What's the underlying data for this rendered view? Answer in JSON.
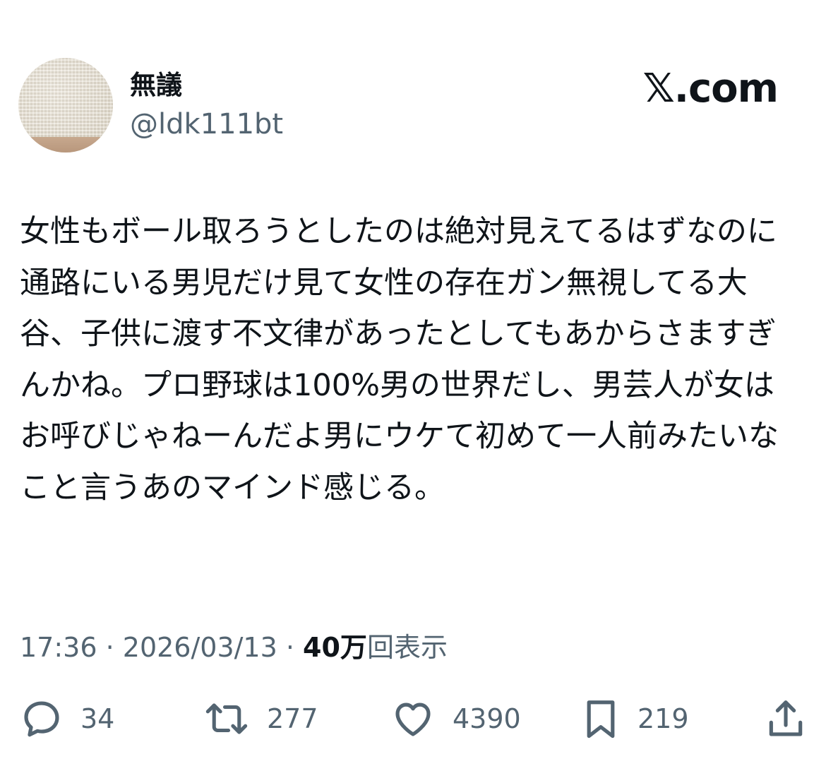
{
  "header": {
    "display_name": "無議",
    "handle": "@ldk111bt",
    "brand": "𝕏.com"
  },
  "tweet": {
    "text": "女性もボール取ろうとしたのは絶対見えてるはずなのに通路にいる男児だけ見て女性の存在ガン無視してる大谷、子供に渡す不文律があったとしてもあからさますぎんかね。プロ野球は100%男の世界だし、男芸人が女はお呼びじゃねーんだよ男にウケて初めて一人前みたいなこと言うあのマインド感じる。"
  },
  "meta": {
    "time": "17:36",
    "separator": " · ",
    "date": "2026/03/13",
    "views_count": "40万",
    "views_label": "回表示"
  },
  "actions": {
    "reply": {
      "icon": "reply-bubble-icon",
      "count": "34"
    },
    "retweet": {
      "icon": "retweet-icon",
      "count": "277"
    },
    "like": {
      "icon": "heart-icon",
      "count": "4390"
    },
    "bookmark": {
      "icon": "bookmark-icon",
      "count": "219"
    },
    "share": {
      "icon": "share-icon"
    }
  },
  "colors": {
    "text_primary": "#0f1419",
    "text_secondary": "#536471",
    "icon": "#536471"
  }
}
